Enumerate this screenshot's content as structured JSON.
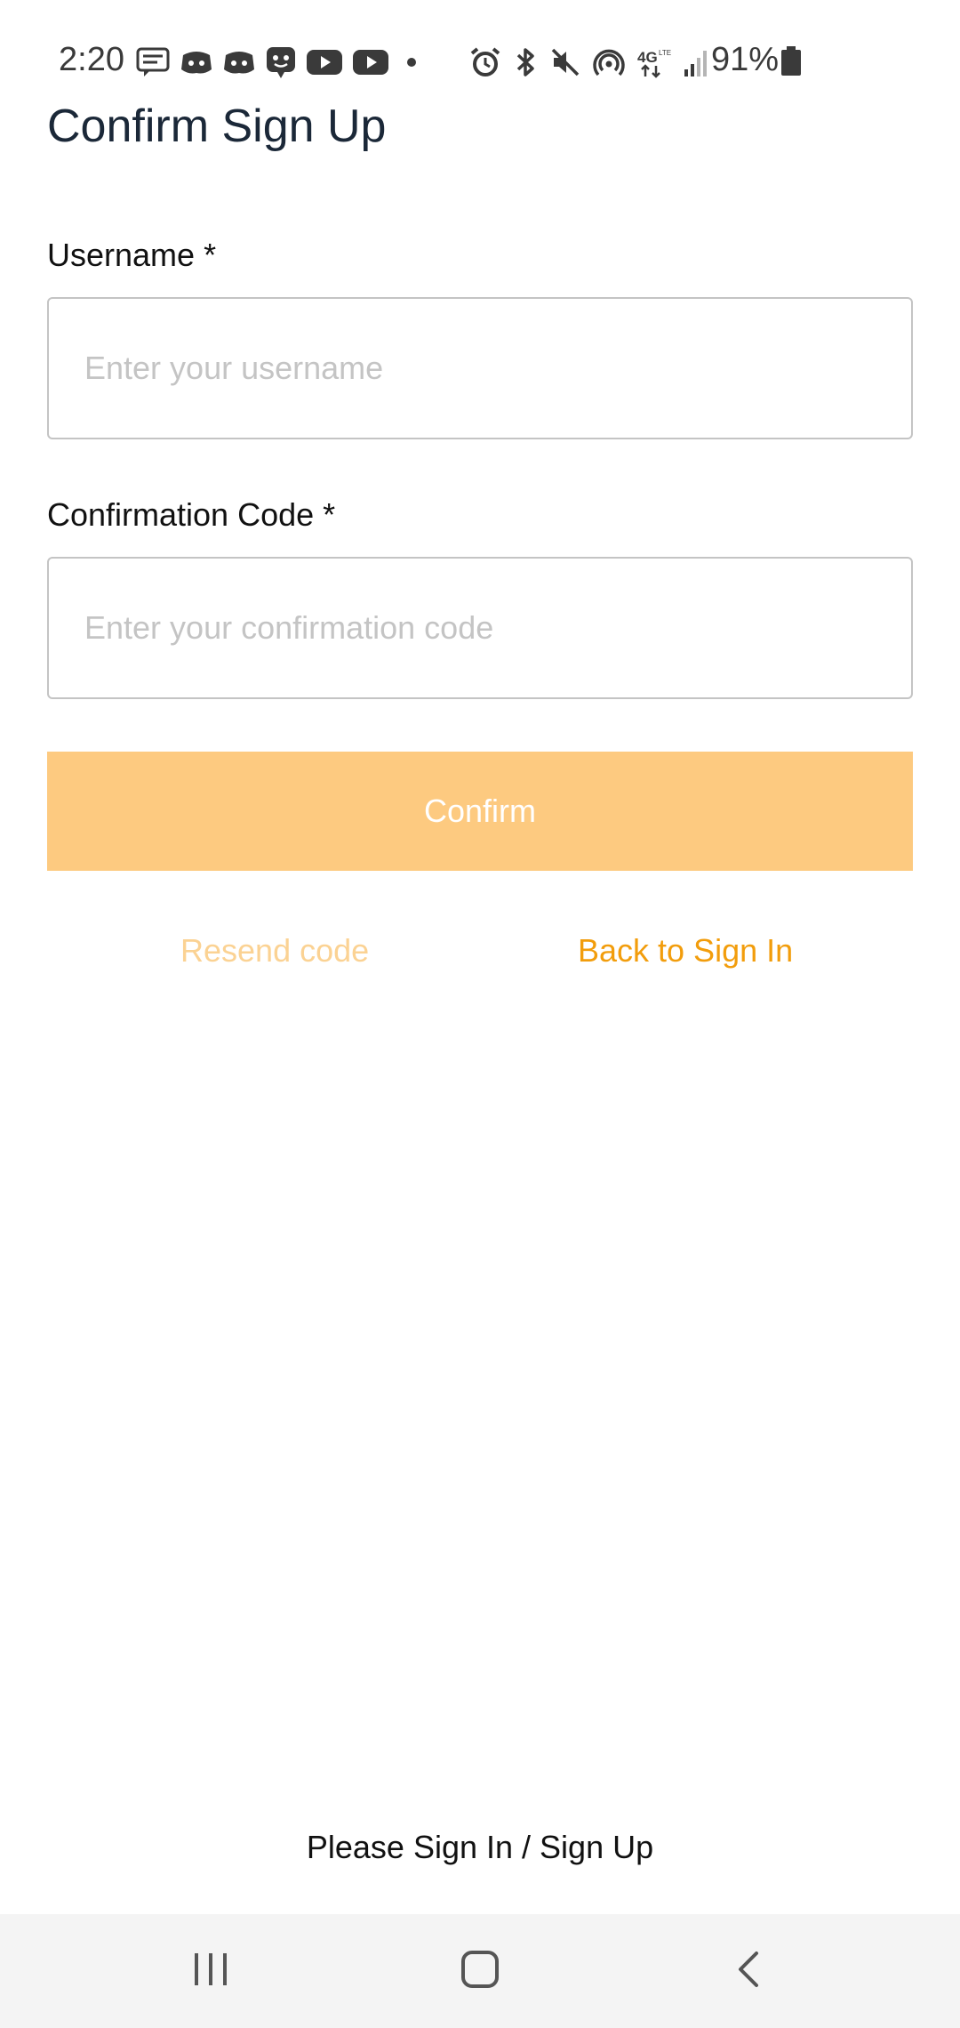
{
  "status_bar": {
    "time": "2:20",
    "battery_percent": "91%",
    "left_icons": [
      "message-icon",
      "discord-icon",
      "discord-icon",
      "chat-bot-icon",
      "youtube-icon",
      "youtube-icon",
      "dot-icon"
    ],
    "right_icons": [
      "alarm-icon",
      "bluetooth-icon",
      "mute-icon",
      "hotspot-icon",
      "4g-network-icon",
      "signal-icon",
      "battery-icon"
    ]
  },
  "page": {
    "title": "Confirm Sign Up"
  },
  "form": {
    "username": {
      "label": "Username *",
      "placeholder": "Enter your username",
      "value": ""
    },
    "code": {
      "label": "Confirmation Code *",
      "placeholder": "Enter your confirmation code",
      "value": ""
    },
    "confirm_label": "Confirm",
    "resend_label": "Resend code",
    "back_label": "Back to Sign In"
  },
  "footer": {
    "text": "Please Sign In / Sign Up"
  },
  "colors": {
    "accent": "#f29d0c",
    "button_disabled": "#fdca80",
    "link_disabled": "#fbd293",
    "title": "#1b2838",
    "input_border": "#c4c4c4",
    "nav_bar": "#f4f4f4"
  }
}
